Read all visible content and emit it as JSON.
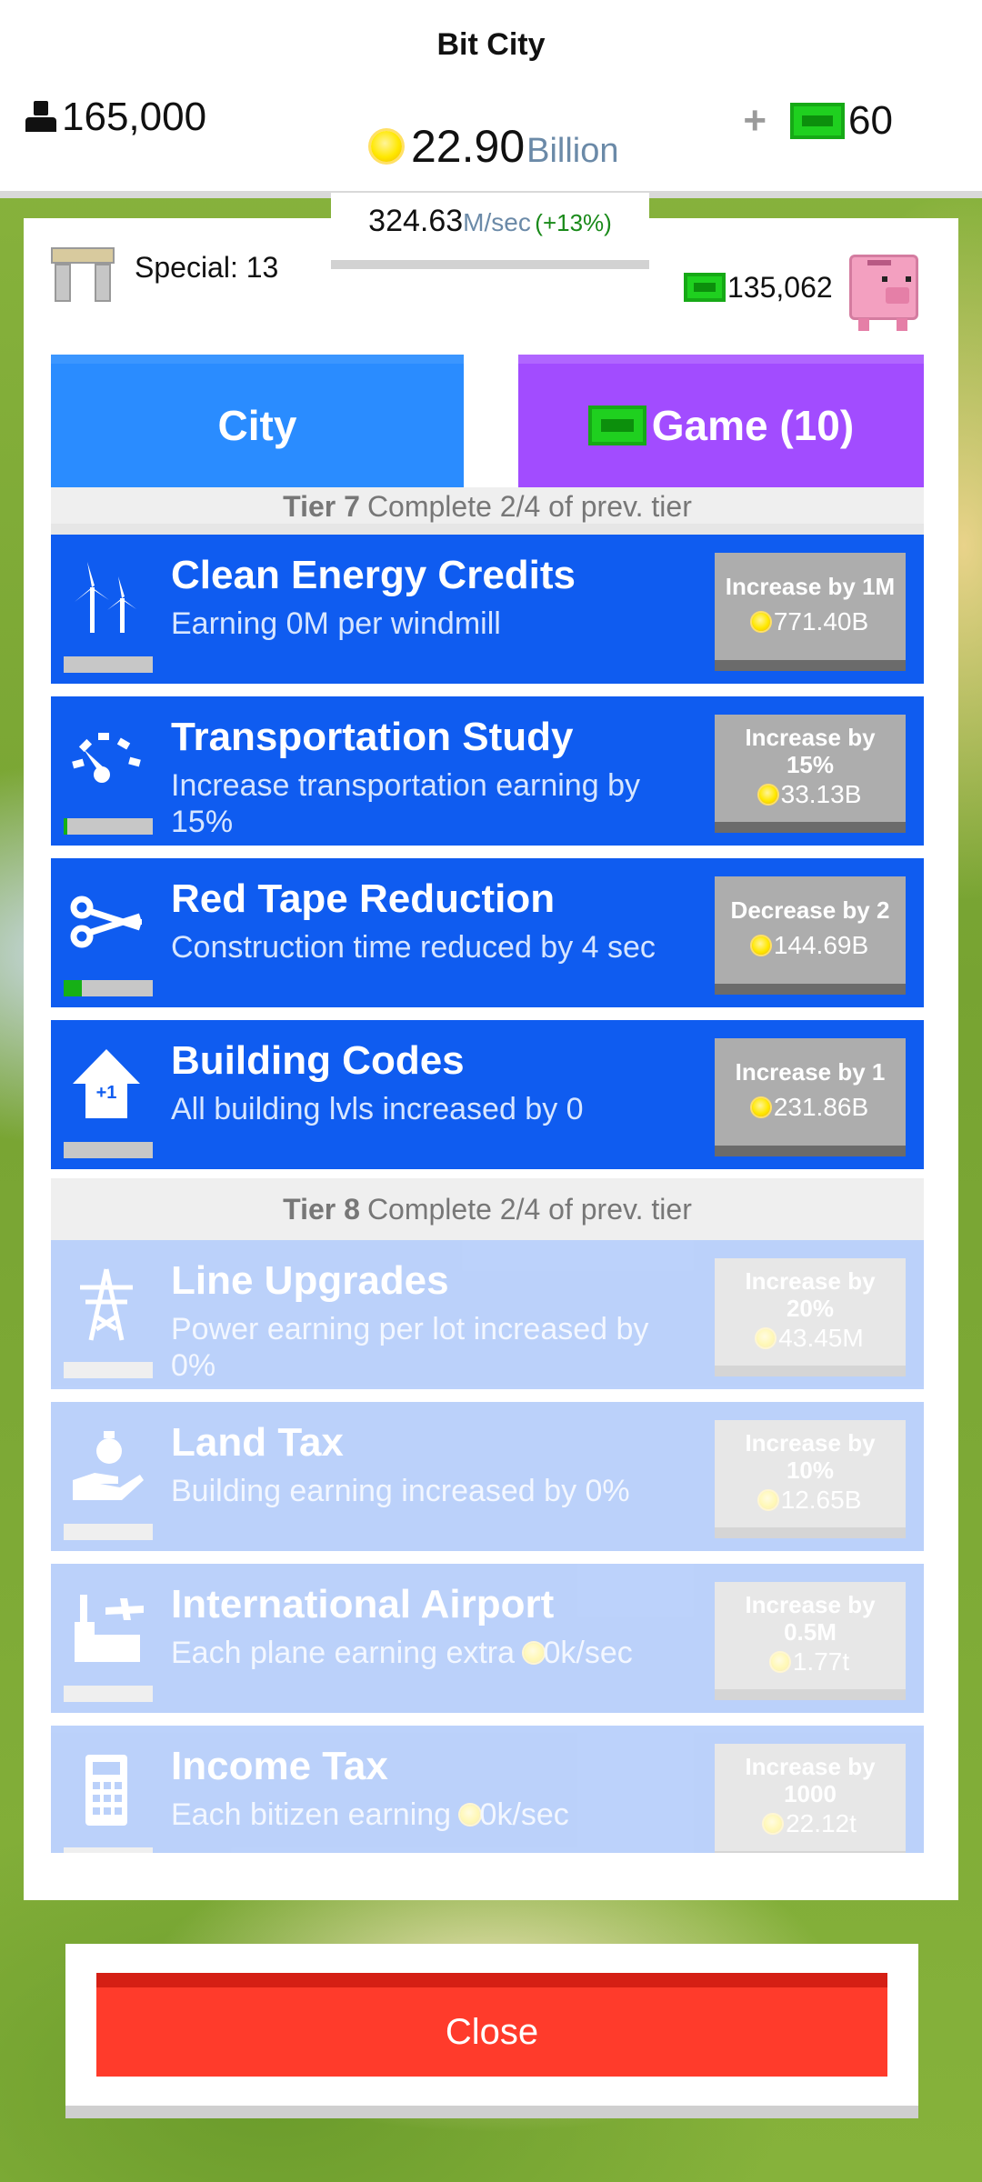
{
  "app": {
    "title": "Bit City"
  },
  "header": {
    "population": "165,000",
    "coins_value": "22.90",
    "coins_unit": "Billion",
    "cash": "60",
    "plus_label": "+"
  },
  "rate": {
    "value": "324.63",
    "unit": "M/sec",
    "bonus": "(+13%)"
  },
  "special": {
    "label": "Special: 13"
  },
  "savings": {
    "value": "135,062"
  },
  "tabs": {
    "city": "City",
    "game": "Game (10)"
  },
  "tiers": {
    "tier7": {
      "name": "Tier 7",
      "req": "Complete 2/4 of prev. tier"
    },
    "tier8": {
      "name": "Tier 8",
      "req": "Complete 2/4 of prev. tier"
    }
  },
  "upgrades": [
    {
      "title": "Clean Energy Credits",
      "desc": "Earning 0M per windmill",
      "action": "Increase by 1M",
      "price": "771.40B",
      "progress": 0,
      "icon": "windmill-icon"
    },
    {
      "title": "Transportation Study",
      "desc": "Increase transportation earning by 15%",
      "action": "Increase by 15%",
      "price": "33.13B",
      "progress": 0.04,
      "icon": "speedometer-icon"
    },
    {
      "title": "Red Tape Reduction",
      "desc": "Construction time reduced by 4 sec",
      "action": "Decrease by 2",
      "price": "144.69B",
      "progress": 0.2,
      "icon": "scissors-icon"
    },
    {
      "title": "Building Codes",
      "desc": "All building lvls increased by 0",
      "action": "Increase by 1",
      "price": "231.86B",
      "progress": 0,
      "icon": "house-up-icon"
    },
    {
      "title": "Line Upgrades",
      "desc": "Power earning per lot increased by 0%",
      "action": "Increase by 20%",
      "price": "43.45M",
      "progress": 0,
      "icon": "power-tower-icon"
    },
    {
      "title": "Land Tax",
      "desc": "Building earning increased by 0%",
      "action": "Increase by 10%",
      "price": "12.65B",
      "progress": 0,
      "icon": "money-hand-icon"
    },
    {
      "title": "International Airport",
      "desc_pre": "Each plane earning extra",
      "desc_post": "0k/sec",
      "action": "Increase by 0.5M",
      "price": "1.77t",
      "progress": 0,
      "icon": "airport-icon"
    },
    {
      "title": "Income Tax",
      "desc_pre": "Each bitizen earning",
      "desc_post": "0k/sec",
      "action": "Increase by 1000",
      "price": "22.12t",
      "progress": 0,
      "icon": "calculator-icon"
    }
  ],
  "close": {
    "label": "Close"
  },
  "colors": {
    "card": "#0f5cf0",
    "city_tab": "#2a8cff",
    "game_tab": "#a24cff",
    "close": "#ff3b2b",
    "cash_green": "#1fd01f"
  }
}
